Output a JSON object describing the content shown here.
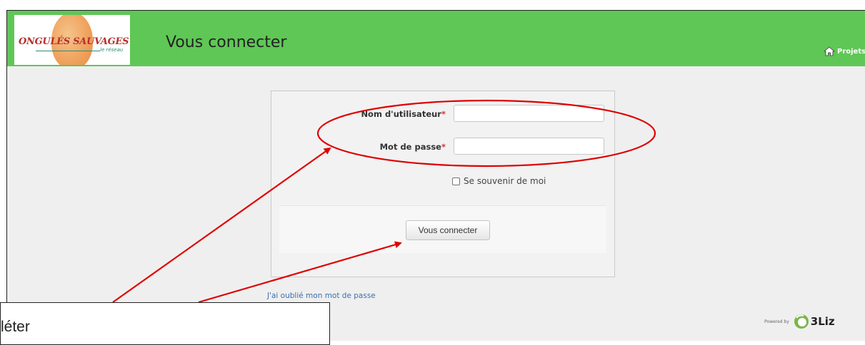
{
  "header": {
    "logo": {
      "title": "ONGULÉS SAUVAGES",
      "subtitle": "le réseau"
    },
    "page_title": "Vous connecter",
    "nav_projects_label": "Projets",
    "colors": {
      "header_bg": "#5fc756",
      "page_bg": "#efefef"
    }
  },
  "login_form": {
    "username": {
      "label": "Nom d'utilisateur",
      "required_mark": "*",
      "value": ""
    },
    "password": {
      "label": "Mot de passe",
      "required_mark": "*",
      "value": ""
    },
    "remember_me": {
      "label": "Se souvenir de moi",
      "checked": false
    },
    "submit_label": "Vous connecter"
  },
  "forgot_password_link": "J'ai oublié mon mot de passe",
  "footer": {
    "powered_by": "Powered by",
    "brand": "3Liz"
  },
  "annotation": {
    "callout_text": "léter",
    "color": "#e00000"
  },
  "icons": {
    "home": "home-icon",
    "liz": "liz-logo-icon"
  }
}
